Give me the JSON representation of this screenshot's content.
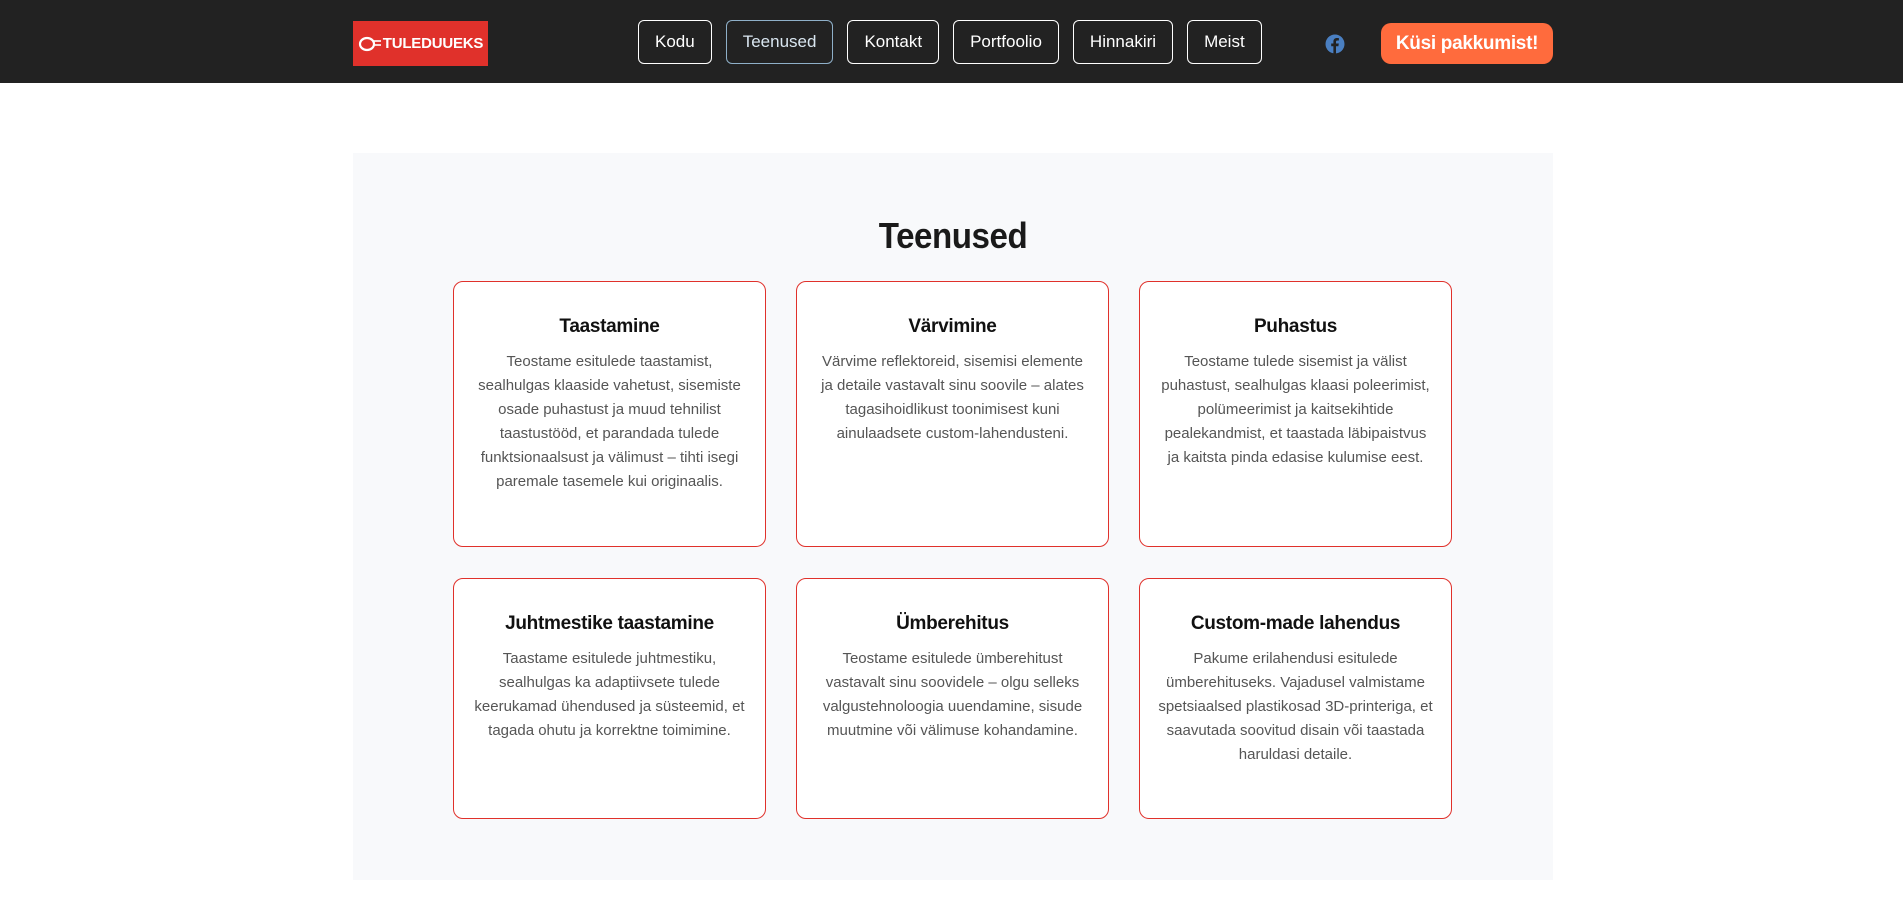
{
  "header": {
    "logo_text": "TULEDUUEKS",
    "nav": [
      {
        "label": "Kodu",
        "active": false
      },
      {
        "label": "Teenused",
        "active": true
      },
      {
        "label": "Kontakt",
        "active": false
      },
      {
        "label": "Portfoolio",
        "active": false
      },
      {
        "label": "Hinnakiri",
        "active": false
      },
      {
        "label": "Meist",
        "active": false
      }
    ],
    "social_icon": "facebook-icon",
    "cta_label": "Küsi pakkumist!"
  },
  "services": {
    "title": "Teenused",
    "cards": [
      {
        "title": "Taastamine",
        "text": "Teostame esitulede taastamist, sealhulgas klaaside vahetust, sisemiste osade puhastust ja muud tehnilist taastustööd, et parandada tulede funktsionaalsust ja välimust – tihti isegi paremale tasemele kui originaalis."
      },
      {
        "title": "Värvimine",
        "text": "Värvime reflektoreid, sisemisi elemente ja detaile vastavalt sinu soovile – alates tagasihoidlikust toonimisest kuni ainulaadsete custom-lahendusteni."
      },
      {
        "title": "Puhastus",
        "text": "Teostame tulede sisemist ja välist puhastust, sealhulgas klaasi poleerimist, polümeerimist ja kaitsekihtide pealekandmist, et taastada läbipaistvus ja kaitsta pinda edasise kulumise eest."
      },
      {
        "title": "Juhtmestike taastamine",
        "text": "Taastame esitulede juhtmestiku, sealhulgas ka adaptiivsete tulede keerukamad ühendused ja süsteemid, et tagada ohutu ja korrektne toimimine."
      },
      {
        "title": "Ümberehitus",
        "text": "Teostame esitulede ümberehitust vastavalt sinu soovidele – olgu selleks valgustehnoloogia uuendamine, sisude muutmine või välimuse kohandamine."
      },
      {
        "title": "Custom-made lahendus",
        "text": "Pakume erilahendusi esitulede ümberehituseks. Vajadusel valmistame spetsiaalsed plastikosad 3D-printeriga, et saavutada soovitud disain või taastada haruldasi detaile."
      }
    ]
  },
  "colors": {
    "header_bg": "#222222",
    "brand_red": "#e0312b",
    "cta_orange": "#ff6b3d",
    "section_bg": "#f8f9fb",
    "facebook_blue": "#4a7fc1"
  }
}
